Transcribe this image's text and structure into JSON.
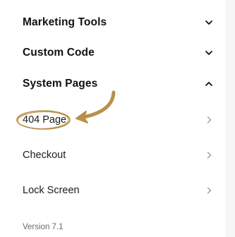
{
  "sections": [
    {
      "label": "Marketing Tools",
      "state": "collapsed",
      "icon": "chevron-down-icon"
    },
    {
      "label": "Custom Code",
      "state": "collapsed",
      "icon": "chevron-down-icon"
    },
    {
      "label": "System Pages",
      "state": "expanded",
      "icon": "chevron-up-icon"
    }
  ],
  "system_pages": [
    {
      "label": "404 Page",
      "icon": "chevron-right-icon",
      "highlighted": true
    },
    {
      "label": "Checkout",
      "icon": "chevron-right-icon"
    },
    {
      "label": "Lock Screen",
      "icon": "chevron-right-icon"
    }
  ],
  "footer": {
    "version": "Version 7.1"
  },
  "colors": {
    "annotation": "#b8904a",
    "text": "#111111",
    "muted": "#6b6b6b",
    "chevron_muted": "#9a9a9a"
  }
}
